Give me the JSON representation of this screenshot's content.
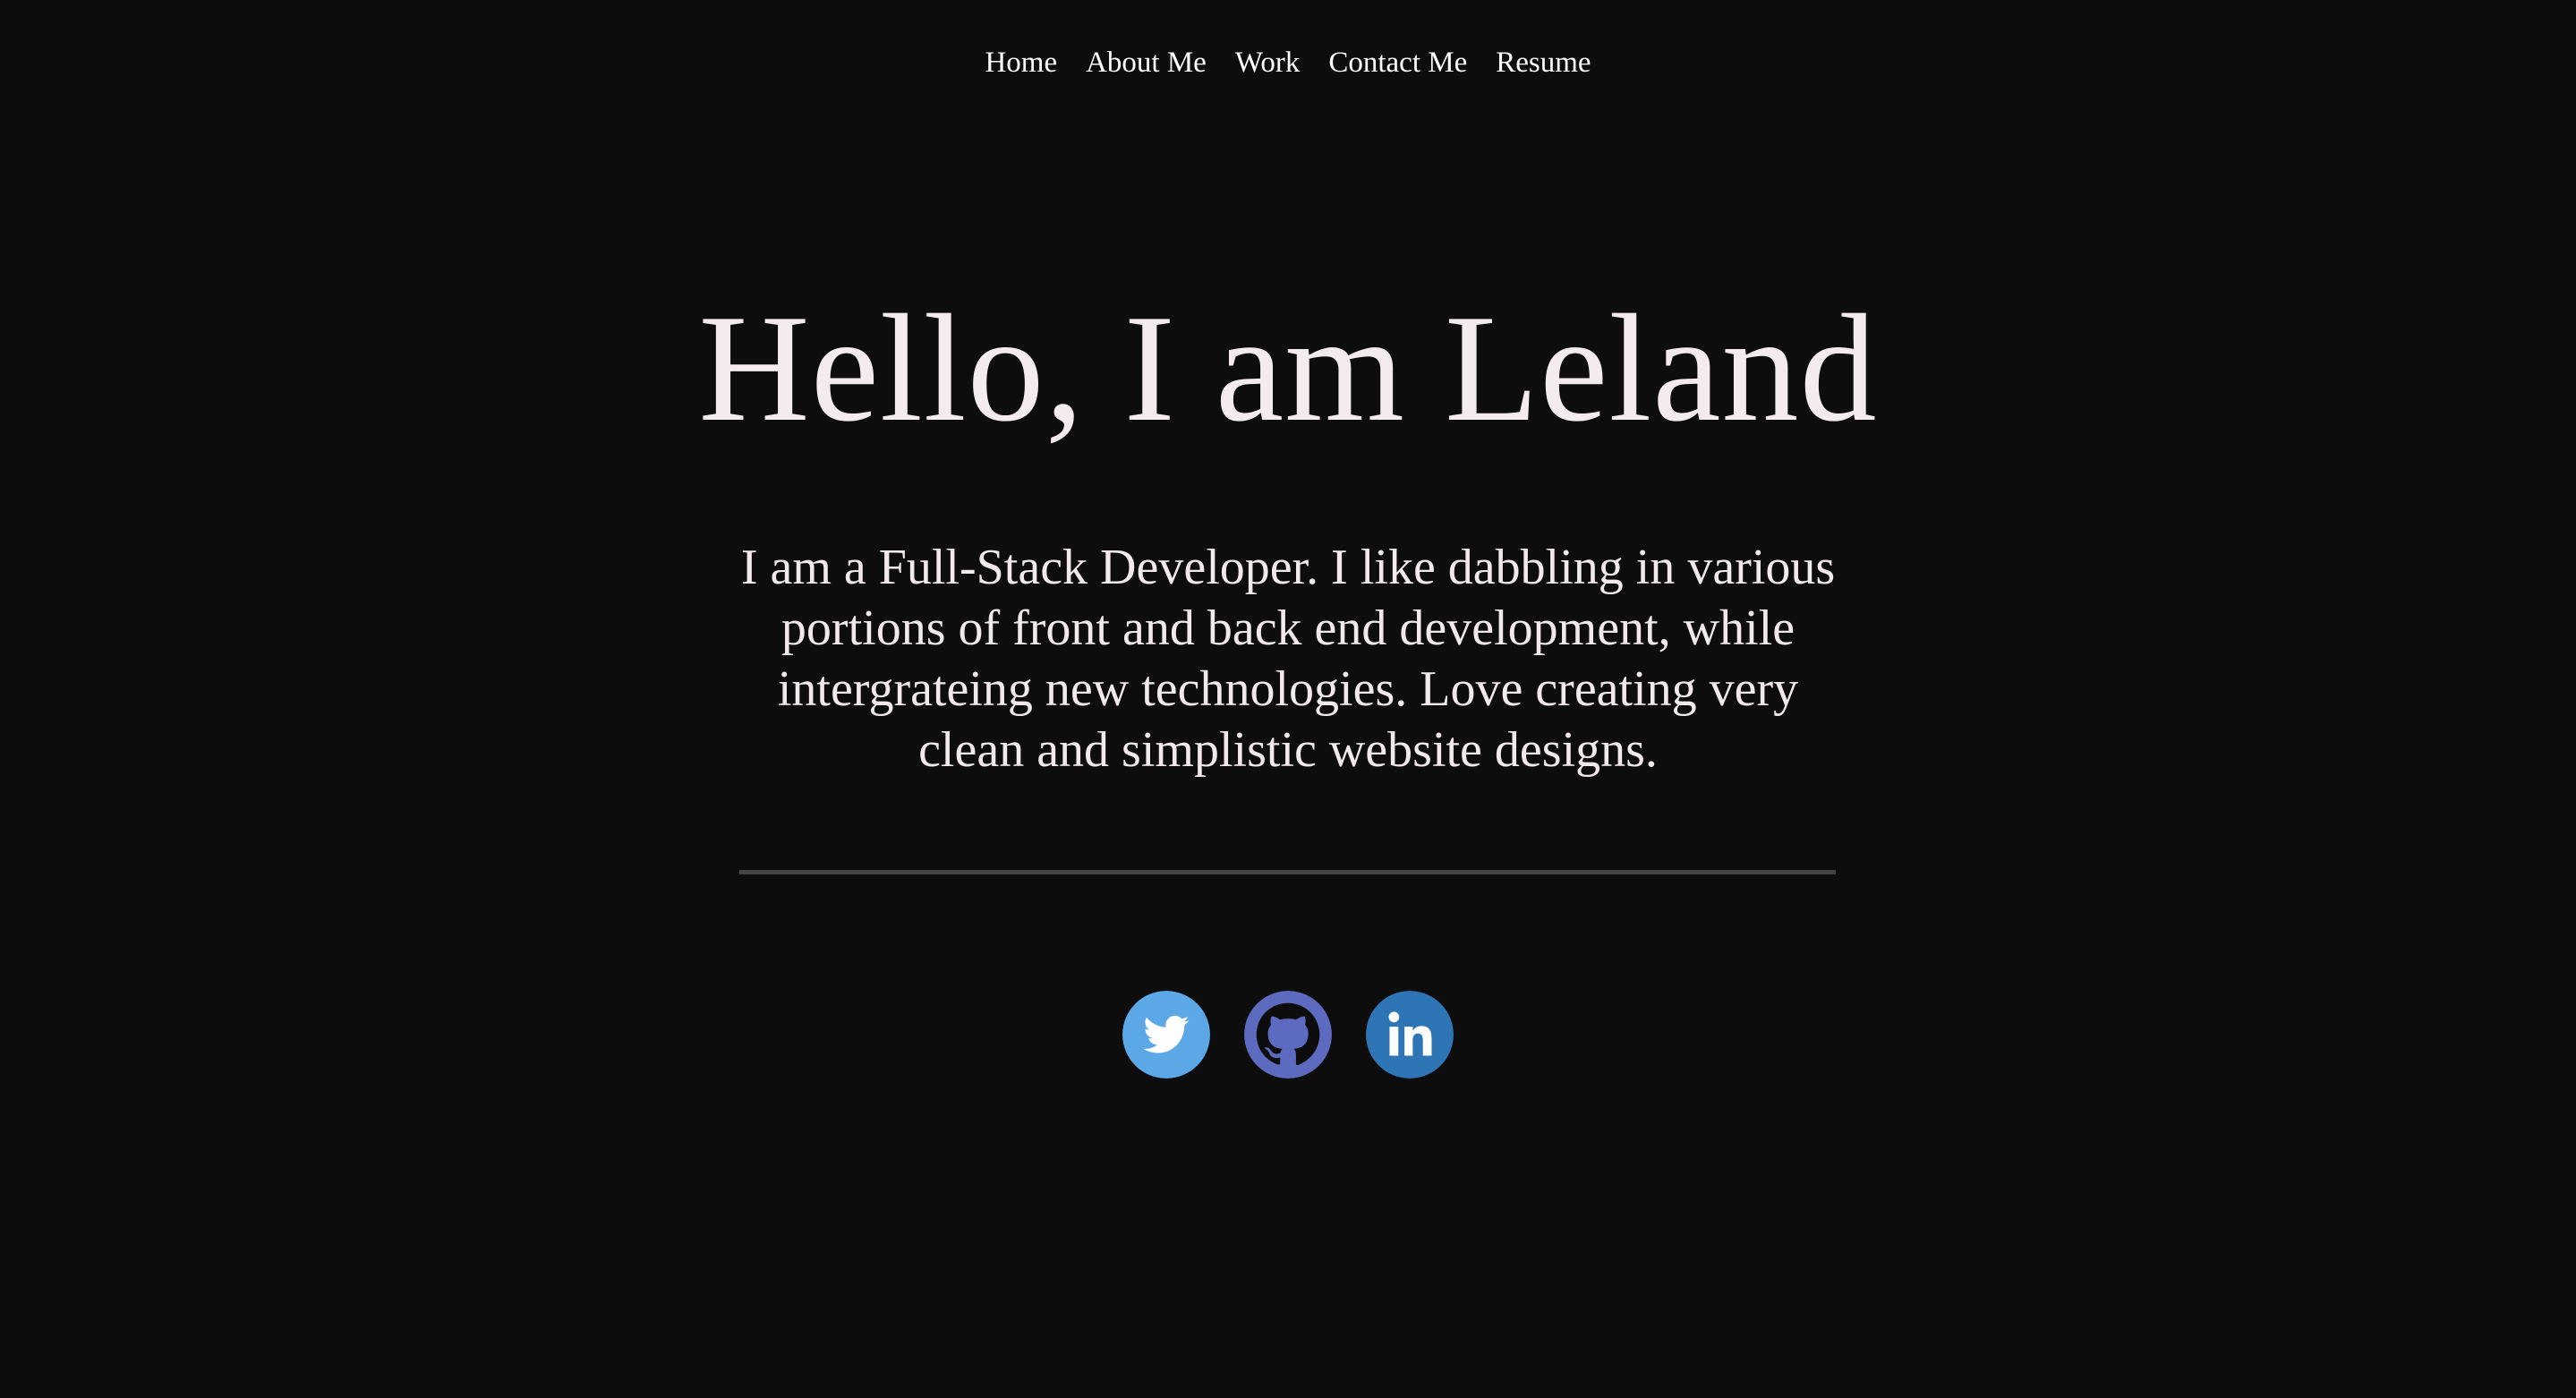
{
  "nav": {
    "items": [
      {
        "label": "Home"
      },
      {
        "label": "About Me"
      },
      {
        "label": "Work"
      },
      {
        "label": "Contact Me"
      },
      {
        "label": "Resume"
      }
    ]
  },
  "hero": {
    "title": "Hello, I am Leland",
    "intro": "I am a Full-Stack Developer. I like dabbling in various portions of front and back end development, while intergrateing new technologies. Love creating very clean and simplistic website designs."
  },
  "socials": [
    {
      "icon": "twitter-icon",
      "color": "#5ca8e6"
    },
    {
      "icon": "github-icon",
      "color": "#5c6bc0"
    },
    {
      "icon": "linkedin-icon",
      "color": "#2e75b6"
    }
  ],
  "colors": {
    "background": "#0d0d0d",
    "text": "#f4ecec",
    "divider": "#444444"
  }
}
